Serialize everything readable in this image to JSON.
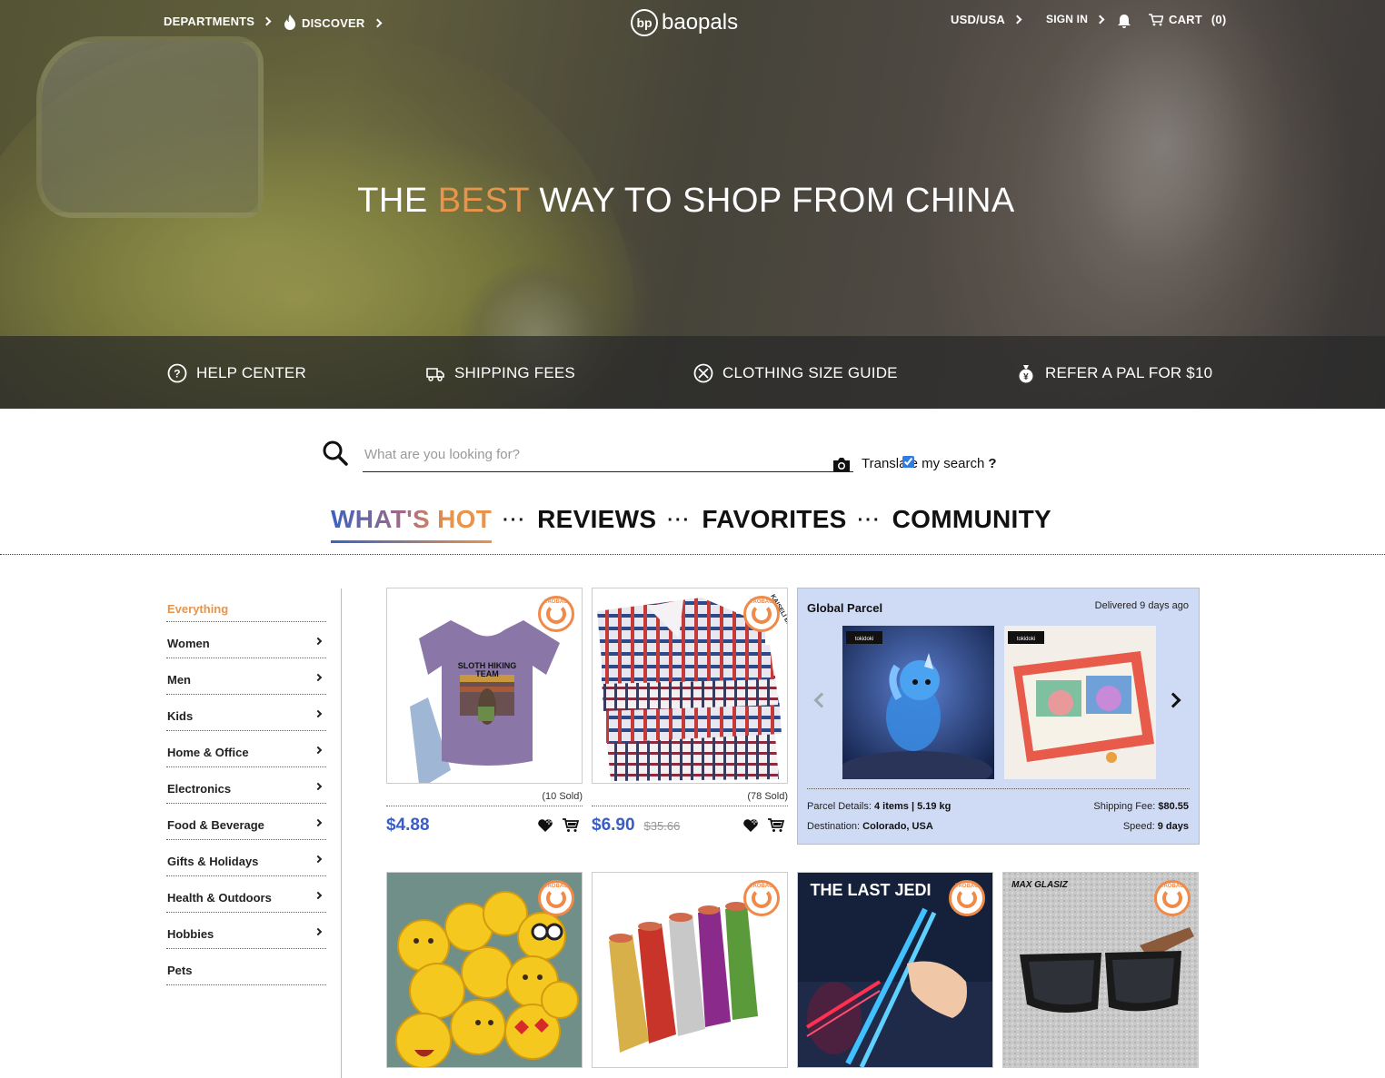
{
  "nav": {
    "departments": "DEPARTMENTS",
    "discover": "DISCOVER",
    "logo": "baopals",
    "logo_mark": "bp",
    "currency": "USD/USA",
    "sign_in": "SIGN IN",
    "cart": "CART",
    "cart_count": "(0)"
  },
  "hero": {
    "headline_pre": "THE ",
    "headline_accent": "BEST",
    "headline_post": " WAY TO SHOP FROM CHINA",
    "accent_color": "#e8954b"
  },
  "help": {
    "help_center": "HELP CENTER",
    "shipping_fees": "SHIPPING FEES",
    "size_guide": "CLOTHING SIZE GUIDE",
    "refer": "REFER A PAL FOR $10"
  },
  "search": {
    "placeholder": "What are you looking for?",
    "translate_label": "Translate my search",
    "translate_q": "?",
    "translate_checked": true
  },
  "tabs": [
    "WHAT'S HOT",
    "REVIEWS",
    "FAVORITES",
    "COMMUNITY"
  ],
  "tab_separator": "···",
  "sidebar": {
    "items": [
      {
        "label": "Everything",
        "has_arrow": false
      },
      {
        "label": "Women",
        "has_arrow": true
      },
      {
        "label": "Men",
        "has_arrow": true
      },
      {
        "label": "Kids",
        "has_arrow": true
      },
      {
        "label": "Home & Office",
        "has_arrow": true
      },
      {
        "label": "Electronics",
        "has_arrow": true
      },
      {
        "label": "Food & Beverage",
        "has_arrow": true
      },
      {
        "label": "Gifts & Holidays",
        "has_arrow": true
      },
      {
        "label": "Health & Outdoors",
        "has_arrow": true
      },
      {
        "label": "Hobbies",
        "has_arrow": true
      },
      {
        "label": "Pets",
        "has_arrow": false
      }
    ]
  },
  "products": [
    {
      "name": "Sloth hiking team t-shirt",
      "shirt_text_1": "SLOTH HIKING",
      "shirt_text_2": "TEAM",
      "sold": "(10 Sold)",
      "price": "$4.88",
      "old_price": ""
    },
    {
      "name": "Stacked plaid shirts",
      "brand": "KAISELI BAOLUO",
      "sold": "(78 Sold)",
      "price": "$6.90",
      "old_price": "$35.66"
    },
    {
      "name": "Emoji pillows"
    },
    {
      "name": "Metallic thread spools"
    },
    {
      "name": "Light-up chopsticks",
      "caption": "THE LAST JEDI"
    },
    {
      "name": "Wooden sunglasses",
      "caption": "MAX GLASIZ"
    }
  ],
  "taobao_label": "TAOBAO",
  "parcel": {
    "title": "Global Parcel",
    "delivered": "Delivered 9 days ago",
    "details_label": "Parcel Details:",
    "details_value": "4 items | 5.19 kg",
    "shipping_label": "Shipping Fee:",
    "shipping_value": "$80.55",
    "destination_label": "Destination:",
    "destination_value": "Colorado, USA",
    "speed_label": "Speed:",
    "speed_value": "9 days",
    "image_badge": "tokidoki"
  },
  "colors": {
    "price_blue": "#3b5cc4",
    "taobao_orange": "#f08a48",
    "parcel_bg": "#cfdaf5"
  }
}
